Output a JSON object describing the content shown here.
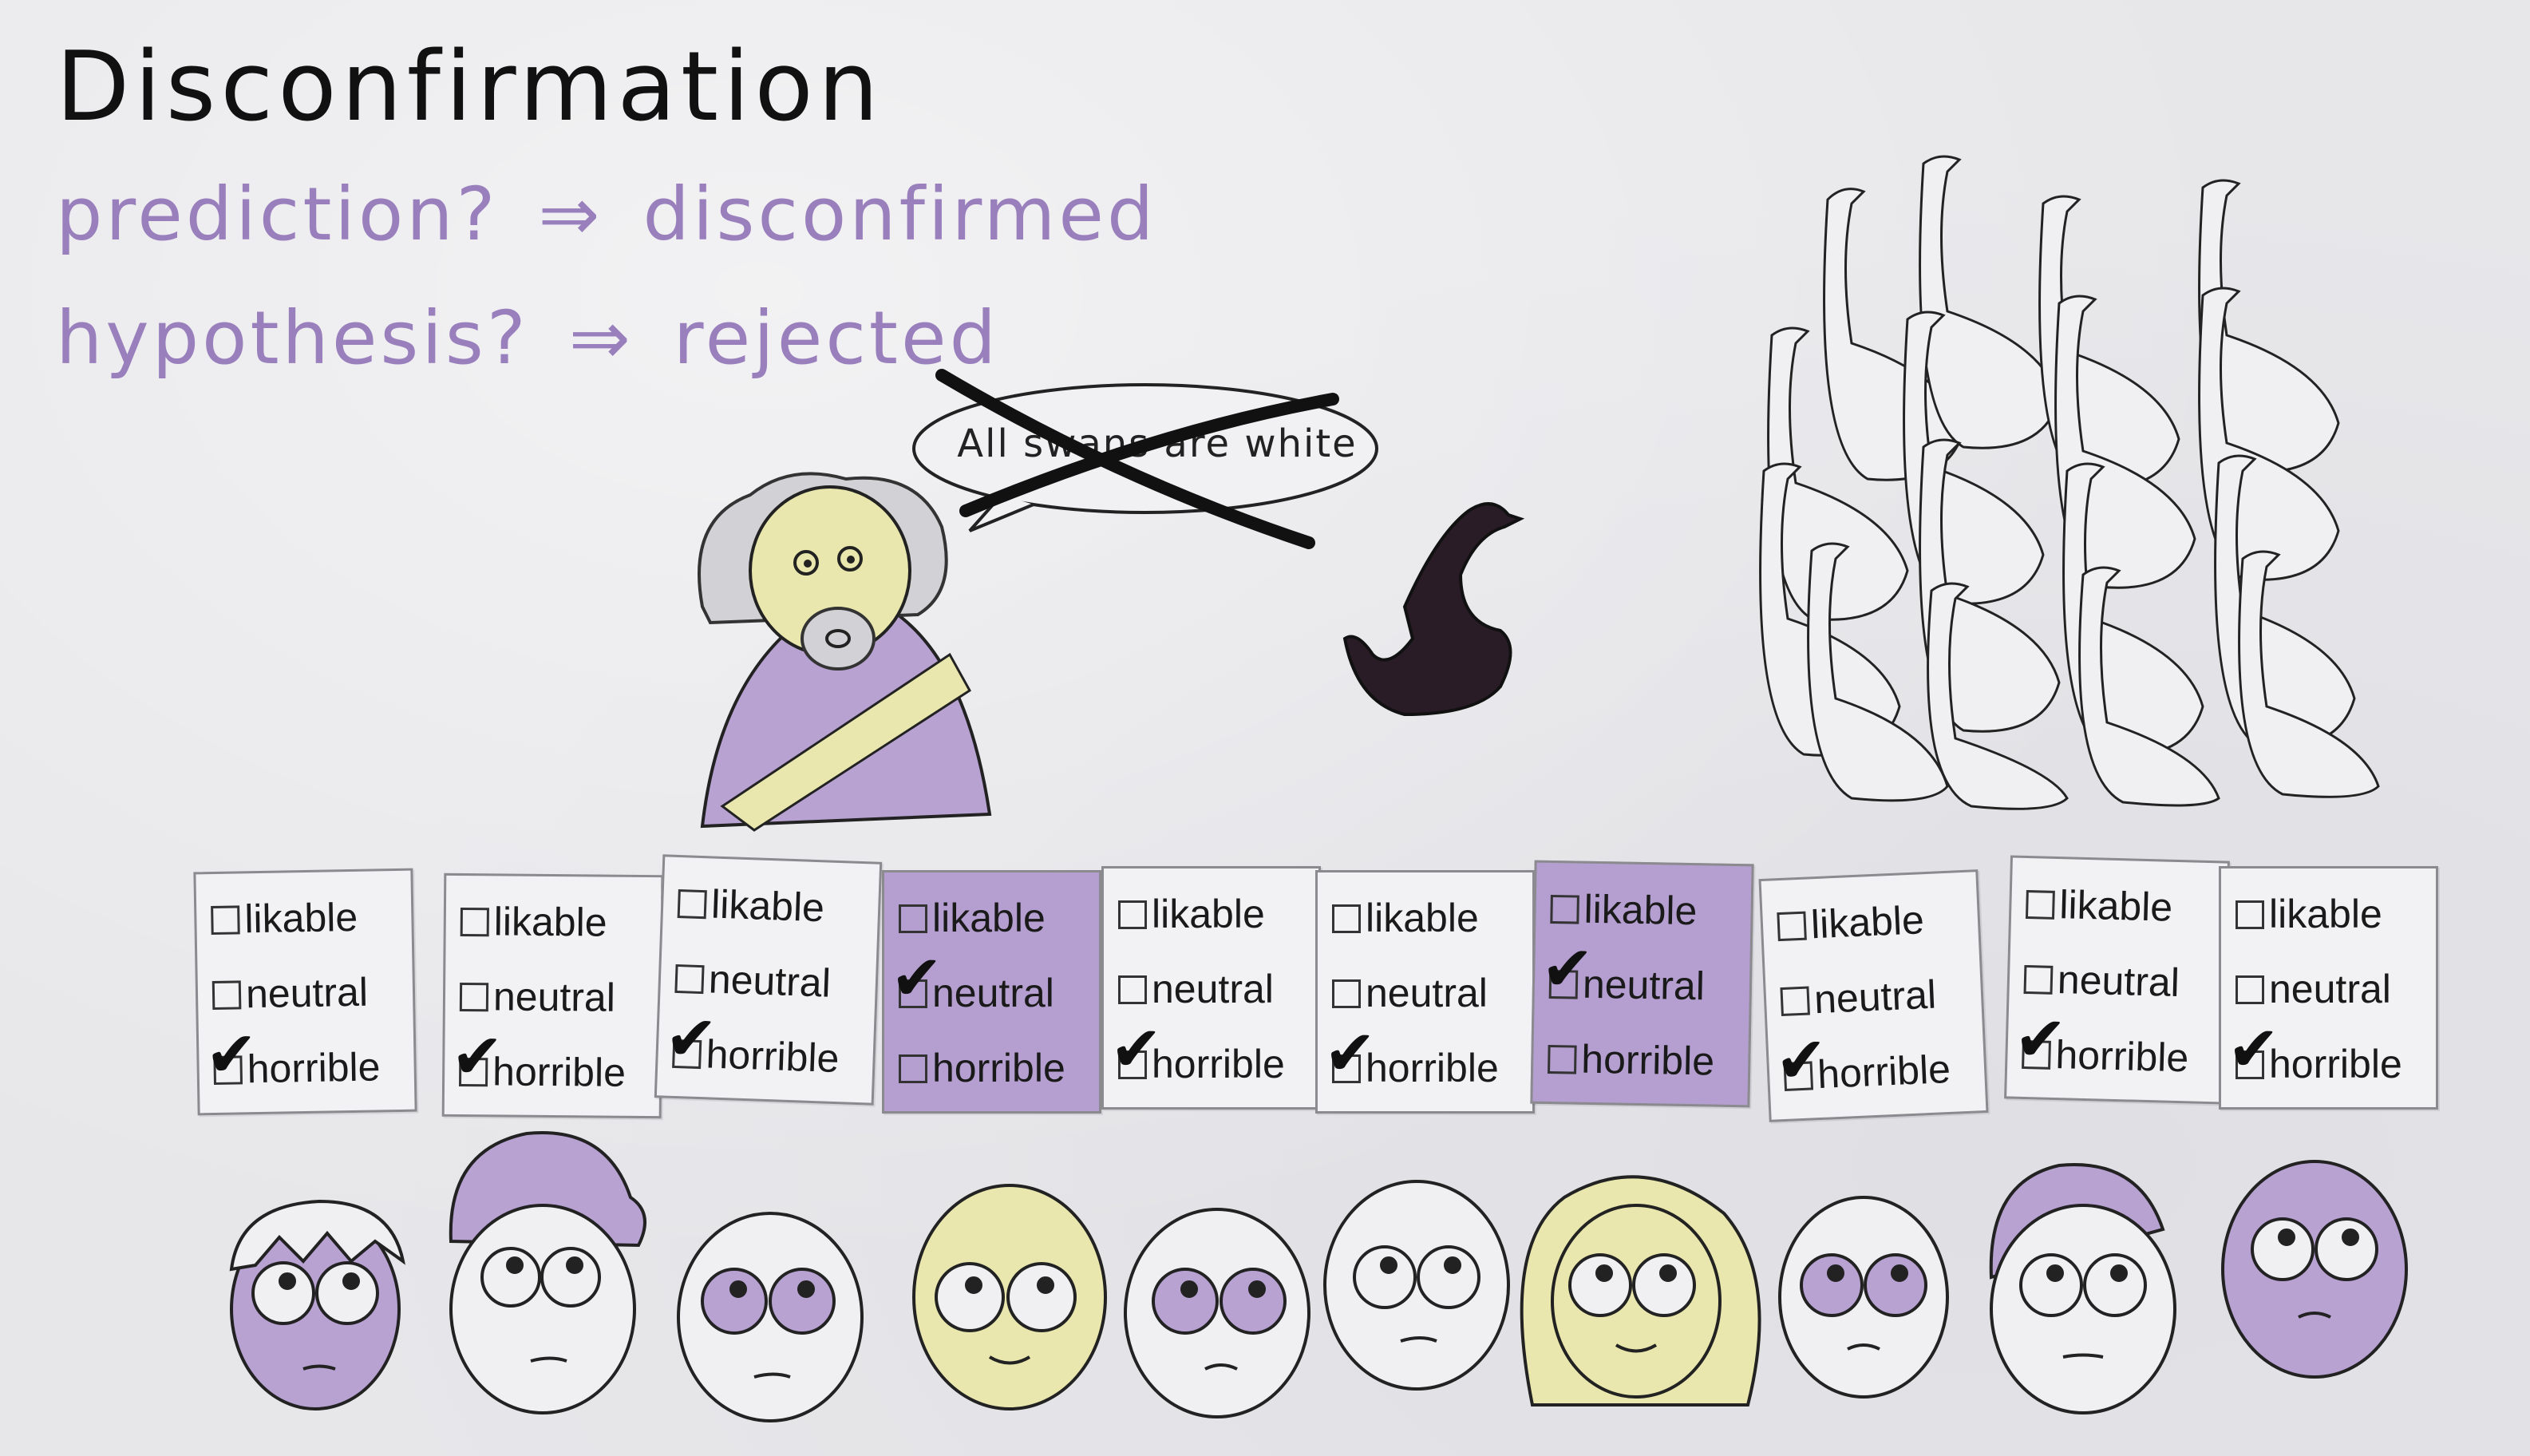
{
  "title": "Disconfirmation",
  "lines": [
    {
      "left": "prediction?",
      "arrow": "⇒",
      "right": "disconfirmed"
    },
    {
      "left": "hypothesis?",
      "arrow": "⇒",
      "right": "rejected"
    }
  ],
  "speech": "All swans are white",
  "card_options": [
    "likable",
    "neutral",
    "horrible"
  ],
  "cards": [
    {
      "checked": "horrible",
      "highlight": false
    },
    {
      "checked": "horrible",
      "highlight": false
    },
    {
      "checked": "horrible",
      "highlight": false
    },
    {
      "checked": "neutral",
      "highlight": true
    },
    {
      "checked": "horrible",
      "highlight": false
    },
    {
      "checked": "horrible",
      "highlight": false
    },
    {
      "checked": "neutral",
      "highlight": true
    },
    {
      "checked": "horrible",
      "highlight": false
    },
    {
      "checked": "horrible",
      "highlight": false
    },
    {
      "checked": "horrible",
      "highlight": false
    }
  ],
  "colors": {
    "ink": "#111111",
    "purple_text": "#9a7fbd",
    "purple_fill": "#b59fd0",
    "yellow_fill": "#e9e7ad",
    "paper": "#e7e7ea"
  }
}
